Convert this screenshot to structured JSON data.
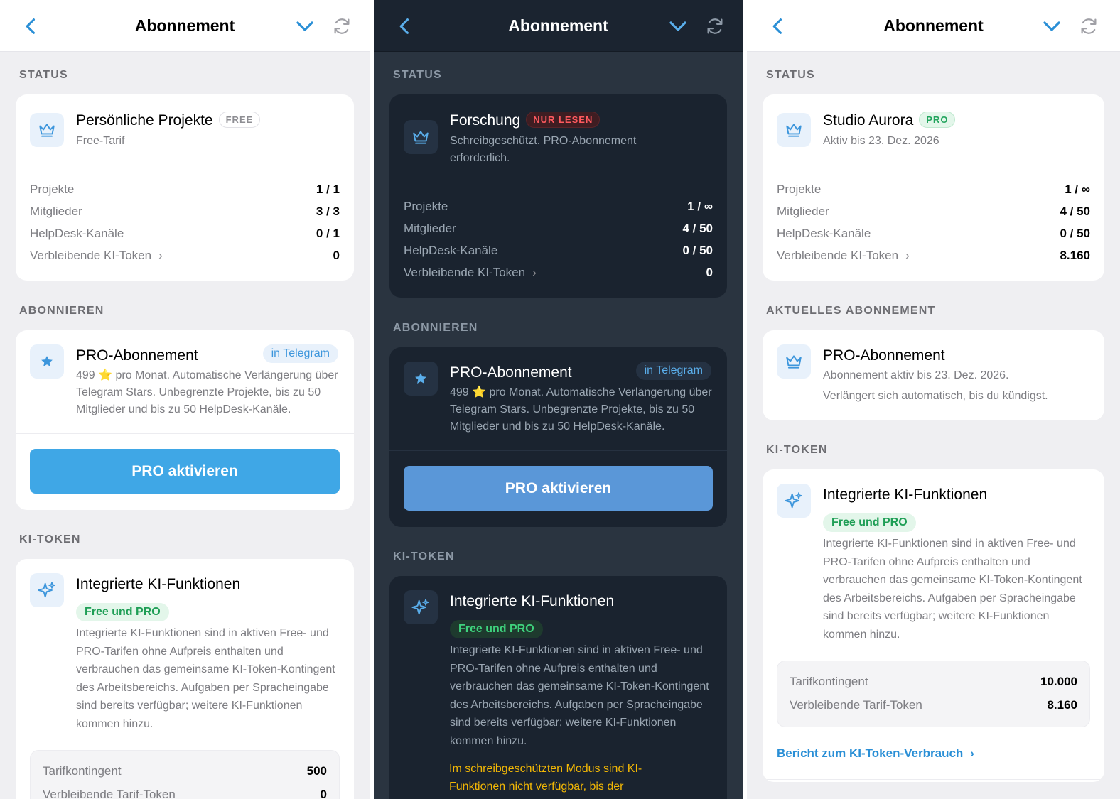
{
  "header": {
    "title": "Abonnement"
  },
  "sections": {
    "status": "STATUS",
    "subscribe": "ABONNIEREN",
    "current": "AKTUELLES ABONNEMENT",
    "tokens": "KI-TOKEN"
  },
  "stats_labels": {
    "projects": "Projekte",
    "members": "Mitglieder",
    "helpdesk": "HelpDesk-Kanäle",
    "ai_tokens": "Verbleibende KI-Token"
  },
  "panel1": {
    "workspace": {
      "name": "Persönliche Projekte",
      "badge": "FREE",
      "plan": "Free-Tarif"
    },
    "stats": {
      "projects": "1 / 1",
      "members": "3 / 3",
      "helpdesk": "0 / 1",
      "ai_tokens": "0"
    },
    "pro": {
      "title": "PRO-Abonnement",
      "tag": "in Telegram",
      "desc_prefix": "499",
      "star": "⭐",
      "desc_suffix": " pro Monat. Automatische Verlängerung über Telegram Stars. Unbegrenzte Projekte, bis zu 50 Mitglieder und bis zu 50 HelpDesk-Kanäle.",
      "button": "PRO aktivieren"
    },
    "ai": {
      "title": "Integrierte KI-Funktionen",
      "tag": "Free und PRO",
      "desc": "Integrierte KI-Funktionen sind in aktiven Free- und PRO-Tarifen ohne Aufpreis enthalten und verbrauchen das gemeinsame KI-Token-Kontingent des Arbeitsbereichs. Aufgaben per Spracheingabe sind bereits verfügbar; weitere KI-Funktionen kommen hinzu.",
      "quota_label": "Tarifkontingent",
      "quota_value": "500",
      "remaining_label": "Verbleibende Tarif-Token",
      "remaining_value": "0"
    }
  },
  "panel2": {
    "workspace": {
      "name": "Forschung",
      "badge": "NUR LESEN",
      "plan": "Schreibgeschützt. PRO-Abonnement erforderlich."
    },
    "stats": {
      "projects": "1 / ∞",
      "members": "4 / 50",
      "helpdesk": "0 / 50",
      "ai_tokens": "0"
    },
    "pro": {
      "title": "PRO-Abonnement",
      "tag": "in Telegram",
      "desc_prefix": "499",
      "star": "⭐",
      "desc_suffix": " pro Monat. Automatische Verlängerung über Telegram Stars. Unbegrenzte Projekte, bis zu 50 Mitglieder und bis zu 50 HelpDesk-Kanäle.",
      "button": "PRO aktivieren"
    },
    "ai": {
      "title": "Integrierte KI-Funktionen",
      "tag": "Free und PRO",
      "desc": "Integrierte KI-Funktionen sind in aktiven Free- und PRO-Tarifen ohne Aufpreis enthalten und verbrauchen das gemeinsame KI-Token-Kontingent des Arbeitsbereichs. Aufgaben per Spracheingabe sind bereits verfügbar; weitere KI-Funktionen kommen hinzu.",
      "warning": "Im schreibgeschützten Modus sind KI-Funktionen nicht verfügbar, bis der"
    }
  },
  "panel3": {
    "workspace": {
      "name": "Studio Aurora",
      "badge": "PRO",
      "plan": "Aktiv bis 23. Dez. 2026"
    },
    "stats": {
      "projects": "1 / ∞",
      "members": "4 / 50",
      "helpdesk": "0 / 50",
      "ai_tokens": "8.160"
    },
    "current": {
      "title": "PRO-Abonnement",
      "line1": "Abonnement aktiv bis 23. Dez. 2026.",
      "line2": "Verlängert sich automatisch, bis du kündigst."
    },
    "ai": {
      "title": "Integrierte KI-Funktionen",
      "tag": "Free und PRO",
      "desc": "Integrierte KI-Funktionen sind in aktiven Free- und PRO-Tarifen ohne Aufpreis enthalten und verbrauchen das gemeinsame KI-Token-Kontingent des Arbeitsbereichs. Aufgaben per Spracheingabe sind bereits verfügbar; weitere KI-Funktionen kommen hinzu.",
      "quota_label": "Tarifkontingent",
      "quota_value": "10.000",
      "remaining_label": "Verbleibende Tarif-Token",
      "remaining_value": "8.160",
      "report_link": "Bericht zum KI-Token-Verbrauch"
    }
  },
  "colors": {
    "accent": "#3fa7e6",
    "accent_dark": "#5a97d8",
    "success": "#22a45d",
    "danger": "#ff5a5f",
    "warning": "#f2b705"
  },
  "icons": {
    "back": "chevron-left-icon",
    "collapse": "chevron-down-icon",
    "refresh": "refresh-icon",
    "plan": "crown-icon",
    "pro": "star-icon",
    "ai": "sparkles-icon"
  }
}
